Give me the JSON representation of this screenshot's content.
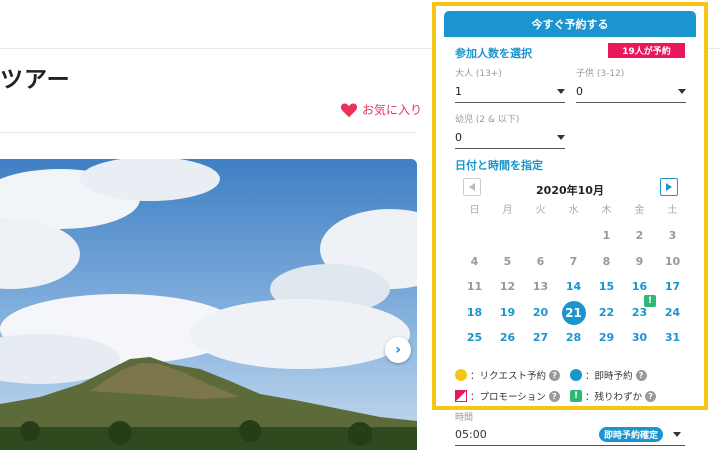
{
  "page": {
    "title": "ツアー",
    "favorite_label": "お気に入り"
  },
  "booking": {
    "header": "今すぐ予約する",
    "participants_title": "参加人数を選択",
    "booked_badge": "19人が予約",
    "adult": {
      "label": "大人 (13+)",
      "value": "1"
    },
    "child": {
      "label": "子供 (3-12)",
      "value": "0"
    },
    "infant": {
      "label": "幼児 (2 & 以下)",
      "value": "0"
    },
    "date_title": "日付と時間を指定",
    "calendar": {
      "month": "2020年10月",
      "weekdays": [
        "日",
        "月",
        "火",
        "水",
        "木",
        "金",
        "土"
      ],
      "weeks": [
        [
          null,
          null,
          null,
          null,
          "1",
          "2",
          "3"
        ],
        [
          "4",
          "5",
          "6",
          "7",
          "8",
          "9",
          "10"
        ],
        [
          "11",
          "12",
          "13",
          "14",
          "15",
          "16",
          "17"
        ],
        [
          "18",
          "19",
          "20",
          "21",
          "22",
          "23",
          "24"
        ],
        [
          "25",
          "26",
          "27",
          "28",
          "29",
          "30",
          "31"
        ]
      ],
      "first_available_day": 14,
      "selected_day": 21,
      "few_left_days": [
        23
      ]
    },
    "legend": {
      "request": "：リクエスト予約",
      "instant": "：即時予約",
      "promotion": "：プロモーション",
      "few_left": "：残りわずか",
      "help_glyph": "?",
      "few_glyph": "!"
    },
    "colors": {
      "accent": "#1a95cf",
      "request": "#f5c518",
      "promotion": "#e8185a",
      "few_left": "#2eb873",
      "highlight_border": "#f5c518"
    },
    "time": {
      "label": "時間",
      "value": "05:00",
      "badge": "即時予約確定"
    }
  },
  "icons": {
    "favorite": "heart-icon",
    "carousel_next": "chevron-right-icon",
    "help": "question-icon",
    "next_glyph": "›"
  }
}
